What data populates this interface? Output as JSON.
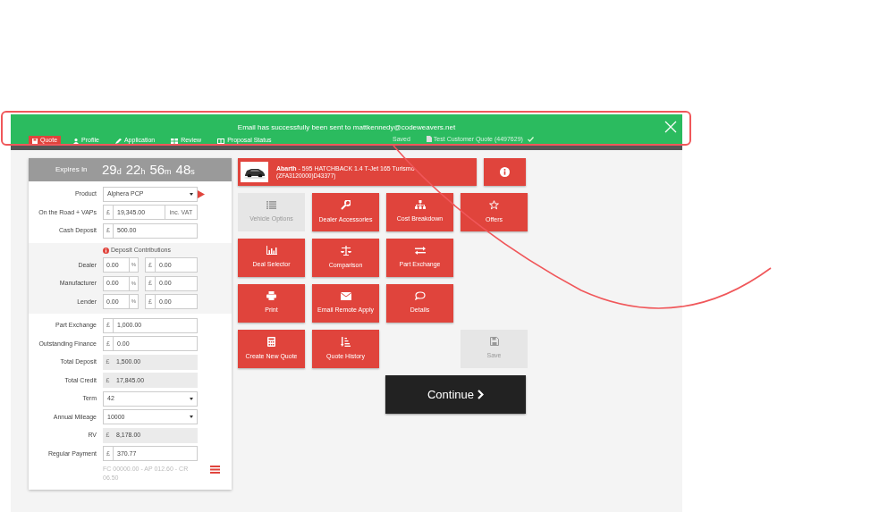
{
  "notification": {
    "message": "Email has successfully been sent to mattkennedy@codeweavers.net"
  },
  "nav": {
    "tabs": [
      {
        "label": "Quote",
        "selected": true
      },
      {
        "label": "Profile",
        "selected": false
      },
      {
        "label": "Application",
        "selected": false
      },
      {
        "label": "Review",
        "selected": false
      },
      {
        "label": "Proposal Status",
        "selected": false
      }
    ],
    "status": "Saved",
    "quote_name": "Test Customer Quote (4497629)"
  },
  "timer": {
    "label": "Expires In",
    "parts": [
      {
        "value": "29",
        "unit": "d"
      },
      {
        "value": "22",
        "unit": "h"
      },
      {
        "value": "56",
        "unit": "m"
      },
      {
        "value": "48",
        "unit": "s"
      }
    ]
  },
  "form": {
    "top_fields": [
      {
        "kind": "select",
        "label": "Product",
        "value": "Alphera PCP"
      },
      {
        "kind": "currency",
        "label": "On the Road + VAPs",
        "prefix": "£",
        "value": "19,345.00",
        "suffix": "inc. VAT"
      },
      {
        "kind": "currency",
        "label": "Cash Deposit",
        "prefix": "£",
        "value": "500.00"
      }
    ],
    "contributions": {
      "title": "Deposit Contributions",
      "rows": [
        {
          "label": "Dealer",
          "percent": "0.00",
          "percent_sign": "%",
          "prefix": "£",
          "amount": "0.00"
        },
        {
          "label": "Manufacturer",
          "percent": "0.00",
          "percent_sign": "%",
          "prefix": "£",
          "amount": "0.00"
        },
        {
          "label": "Lender",
          "percent": "0.00",
          "percent_sign": "%",
          "prefix": "£",
          "amount": "0.00"
        }
      ]
    },
    "fields": [
      {
        "kind": "currency",
        "label": "Part Exchange",
        "prefix": "£",
        "value": "1,000.00"
      },
      {
        "kind": "currency",
        "label": "Outstanding Finance",
        "prefix": "£",
        "value": "0.00"
      },
      {
        "kind": "readonly",
        "label": "Total Deposit",
        "prefix": "£",
        "value": "1,500.00"
      },
      {
        "kind": "readonly",
        "label": "Total Credit",
        "prefix": "£",
        "value": "17,845.00"
      },
      {
        "kind": "select",
        "label": "Term",
        "value": "42"
      },
      {
        "kind": "select",
        "label": "Annual Mileage",
        "value": "10000"
      },
      {
        "kind": "readonly",
        "label": "RV",
        "prefix": "£",
        "value": "8,178.00"
      },
      {
        "kind": "currency",
        "label": "Regular Payment",
        "prefix": "£",
        "value": "370.77"
      }
    ],
    "summary": "FC 00000.00 - AP 012.60 - CR 06.50"
  },
  "vehicle": {
    "make": "Abarth",
    "model": " - 595 HATCHBACK 1.4 T-Jet 165 Turismo",
    "code": "(ZFA3120000)D43377)"
  },
  "tiles": [
    {
      "label": "Vehicle Options",
      "disabled": true
    },
    {
      "label": "Dealer Accessories",
      "disabled": false
    },
    {
      "label": "Cost Breakdown",
      "disabled": false
    },
    {
      "label": "Offers",
      "disabled": false
    },
    {
      "label": "Deal Selector",
      "disabled": false
    },
    {
      "label": "Comparison",
      "disabled": false
    },
    {
      "label": "Part Exchange",
      "disabled": false
    },
    {
      "label": "Print",
      "disabled": false
    },
    {
      "label": "Email Remote Apply",
      "disabled": false
    },
    {
      "label": "Details",
      "disabled": false
    },
    {
      "label": "Create New Quote",
      "disabled": false
    },
    {
      "label": "Quote History",
      "disabled": false
    },
    {
      "label": "Save",
      "disabled": true
    }
  ],
  "continue_button": {
    "label": "Continue"
  }
}
